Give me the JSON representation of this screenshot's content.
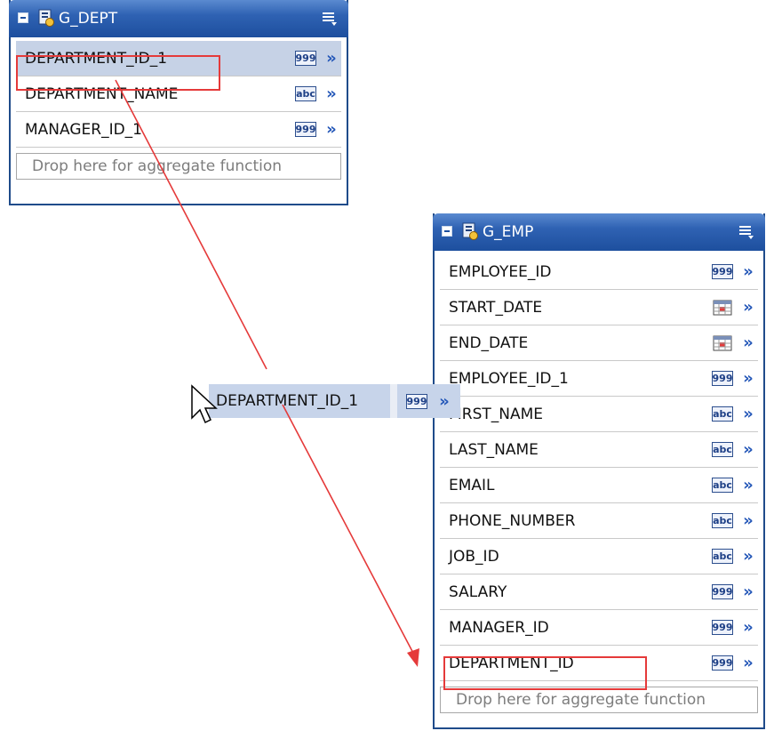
{
  "g_dept": {
    "title": "G_DEPT",
    "rows": [
      {
        "label": "DEPARTMENT_ID_1",
        "type": "999"
      },
      {
        "label": "DEPARTMENT_NAME",
        "type": "abc"
      },
      {
        "label": "MANAGER_ID_1",
        "type": "999"
      }
    ],
    "drop_text": "Drop here for aggregate function"
  },
  "g_emp": {
    "title": "G_EMP",
    "rows": [
      {
        "label": "EMPLOYEE_ID",
        "type": "999"
      },
      {
        "label": "START_DATE",
        "type": "date"
      },
      {
        "label": "END_DATE",
        "type": "date"
      },
      {
        "label": "EMPLOYEE_ID_1",
        "type": "999"
      },
      {
        "label": "FIRST_NAME",
        "type": "abc"
      },
      {
        "label": "LAST_NAME",
        "type": "abc"
      },
      {
        "label": "EMAIL",
        "type": "abc"
      },
      {
        "label": "PHONE_NUMBER",
        "type": "abc"
      },
      {
        "label": "JOB_ID",
        "type": "abc"
      },
      {
        "label": "SALARY",
        "type": "999"
      },
      {
        "label": "MANAGER_ID",
        "type": "999"
      },
      {
        "label": "DEPARTMENT_ID",
        "type": "999"
      }
    ],
    "drop_text": "Drop here for aggregate function"
  },
  "drag": {
    "label": "DEPARTMENT_ID_1",
    "type": "999"
  },
  "colors": {
    "header": "#2f62b3",
    "selected_row": "#c6d2e6",
    "highlight": "#e53a3a",
    "chevron": "#2457b8"
  },
  "icons": {
    "collapse": "collapse-icon",
    "group": "data-group-icon",
    "menu": "menu-icon",
    "expand_column": "double-chevron-right-icon",
    "date": "calendar-icon",
    "cursor": "arrow-cursor-icon"
  }
}
